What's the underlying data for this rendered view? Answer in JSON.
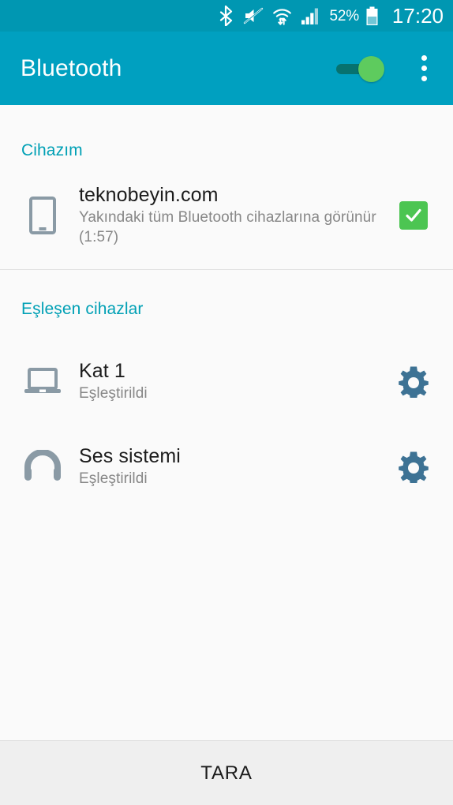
{
  "status_bar": {
    "background_color": "#0097b2",
    "icons": [
      "bluetooth-icon",
      "volume-muted-icon",
      "wifi-transfer-icon",
      "cellular-signal-icon"
    ],
    "battery_percent": "52%",
    "battery_icon": "battery-icon",
    "clock": "17:20"
  },
  "app_bar": {
    "title": "Bluetooth",
    "background_color": "#00a0c0",
    "toggle": {
      "name": "bluetooth-toggle",
      "state": "on",
      "thumb_color": "#5ecb5e",
      "track_color": "#07726f"
    },
    "overflow_icon": "overflow-menu-icon"
  },
  "sections": [
    {
      "header": "Cihazım",
      "header_color": "#00a0b5",
      "devices": [
        {
          "icon": "phone-icon",
          "name": "teknobeyin.com",
          "status": "Yakındaki tüm Bluetooth cihazlarına görünür (1:57)",
          "action": "visibility-checkbox",
          "action_state": "checked",
          "action_color": "#4cc552"
        }
      ]
    },
    {
      "header": "Eşleşen cihazlar",
      "header_color": "#00a0b5",
      "devices": [
        {
          "icon": "laptop-icon",
          "name": "Kat 1",
          "status": "Eşleştirildi",
          "action": "device-settings-gear",
          "action_color": "#3d7294"
        },
        {
          "icon": "headphones-icon",
          "name": "Ses sistemi",
          "status": "Eşleştirildi",
          "action": "device-settings-gear",
          "action_color": "#3d7294"
        }
      ]
    }
  ],
  "bottom_bar": {
    "scan_label": "TARA"
  }
}
